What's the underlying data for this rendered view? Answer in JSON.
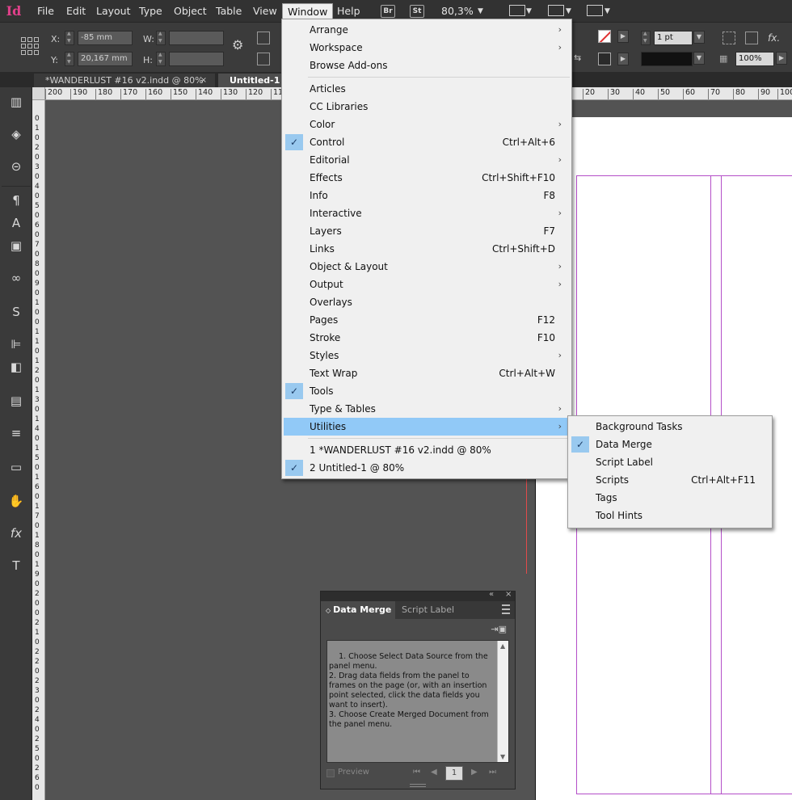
{
  "app": {
    "logo_text": "Id"
  },
  "menubar": {
    "items": [
      {
        "label": "File"
      },
      {
        "label": "Edit"
      },
      {
        "label": "Layout"
      },
      {
        "label": "Type"
      },
      {
        "label": "Object"
      },
      {
        "label": "Table"
      },
      {
        "label": "View"
      },
      {
        "label": "Window"
      },
      {
        "label": "Help"
      }
    ],
    "bridge_badge": "Br",
    "stock_badge": "St",
    "zoom": "80,3%"
  },
  "controlbar": {
    "x_label": "X:",
    "x_value": "-85 mm",
    "y_label": "Y:",
    "y_value": "20,167 mm",
    "w_label": "W:",
    "w_value": "",
    "h_label": "H:",
    "h_value": "",
    "stroke_weight": "1 pt",
    "opacity": "100%",
    "fx_label": "fx."
  },
  "tabs": [
    {
      "label": "*WANDERLUST #16 v2.indd @ 80%",
      "close": "×"
    },
    {
      "label": "Untitled-1 @ 80%"
    }
  ],
  "ruler": {
    "h_ticks": [
      "200",
      "190",
      "180",
      "170",
      "160",
      "150",
      "140",
      "130",
      "120",
      "110"
    ],
    "h_ticks_right": [
      "20",
      "30",
      "40",
      "50",
      "60",
      "70",
      "80",
      "90",
      "100"
    ],
    "v_digits": [
      "0",
      "1",
      "0",
      "2",
      "0",
      "3",
      "0",
      "4",
      "0",
      "5",
      "0",
      "6",
      "0",
      "7",
      "0",
      "8",
      "0",
      "9",
      "0",
      "1",
      "0",
      "0",
      "1",
      "1",
      "0",
      "1",
      "2",
      "0",
      "1",
      "3",
      "0",
      "1",
      "4",
      "0",
      "1",
      "5",
      "0",
      "1",
      "6",
      "0",
      "1",
      "7",
      "0",
      "1",
      "8",
      "0",
      "1",
      "9",
      "0",
      "2",
      "0",
      "0",
      "2",
      "1",
      "0",
      "2",
      "2",
      "0",
      "2",
      "3",
      "0",
      "2",
      "4",
      "0",
      "2",
      "5",
      "0",
      "2",
      "6",
      "0"
    ]
  },
  "window_menu": {
    "items": [
      {
        "label": "Arrange",
        "submenu": true
      },
      {
        "label": "Workspace",
        "submenu": true
      },
      {
        "label": "Browse Add-ons"
      },
      {
        "label": "Articles"
      },
      {
        "label": "CC Libraries"
      },
      {
        "label": "Color",
        "submenu": true
      },
      {
        "label": "Control",
        "shortcut": "Ctrl+Alt+6",
        "checked": true
      },
      {
        "label": "Editorial",
        "submenu": true
      },
      {
        "label": "Effects",
        "shortcut": "Ctrl+Shift+F10"
      },
      {
        "label": "Info",
        "shortcut": "F8"
      },
      {
        "label": "Interactive",
        "submenu": true
      },
      {
        "label": "Layers",
        "shortcut": "F7"
      },
      {
        "label": "Links",
        "shortcut": "Ctrl+Shift+D"
      },
      {
        "label": "Object & Layout",
        "submenu": true
      },
      {
        "label": "Output",
        "submenu": true
      },
      {
        "label": "Overlays"
      },
      {
        "label": "Pages",
        "shortcut": "F12"
      },
      {
        "label": "Stroke",
        "shortcut": "F10"
      },
      {
        "label": "Styles",
        "submenu": true
      },
      {
        "label": "Text Wrap",
        "shortcut": "Ctrl+Alt+W"
      },
      {
        "label": "Tools",
        "checked": true
      },
      {
        "label": "Type & Tables",
        "submenu": true
      },
      {
        "label": "Utilities",
        "submenu": true,
        "highlighted": true
      },
      {
        "label": "1 *WANDERLUST #16 v2.indd @ 80%"
      },
      {
        "label": "2 Untitled-1 @ 80%",
        "checked": true
      }
    ],
    "checkmark": "✓",
    "submenu_arrow": "›"
  },
  "utilities_submenu": {
    "items": [
      {
        "label": "Background Tasks"
      },
      {
        "label": "Data Merge",
        "checked": true
      },
      {
        "label": "Script Label"
      },
      {
        "label": "Scripts",
        "shortcut": "Ctrl+Alt+F11"
      },
      {
        "label": "Tags"
      },
      {
        "label": "Tool Hints"
      }
    ]
  },
  "data_merge_panel": {
    "collapse_icon": "«",
    "close_icon": "×",
    "tab_active": "Data Merge",
    "tab_active_prefix": "◇",
    "tab_inactive": "Script Label",
    "instructions": "1. Choose Select Data Source from the panel menu.\n2. Drag data fields from the panel to frames on the page (or, with an insertion point selected, click the data fields you want to insert).\n3. Choose Create Merged Document from the panel menu.",
    "preview_label": "Preview",
    "record_number": "1"
  },
  "colors": {
    "accent_highlight": "#91c9f7",
    "logo": "#e0408a",
    "margin_guide": "#b44fc8",
    "bleed_guide": "#e24b4b"
  },
  "icons": {
    "tools": [
      "pages-panel-icon",
      "layers-icon",
      "links-icon",
      "paragraph-styles-icon",
      "character-styles-icon",
      "object-styles-icon",
      "cc-libraries-icon",
      "swatches-icon",
      "align-icon",
      "pathfinder-icon",
      "text-wrap-icon",
      "stroke-icon",
      "gradient-icon",
      "color-icon",
      "effects-icon",
      "text-frame-options-icon"
    ]
  }
}
